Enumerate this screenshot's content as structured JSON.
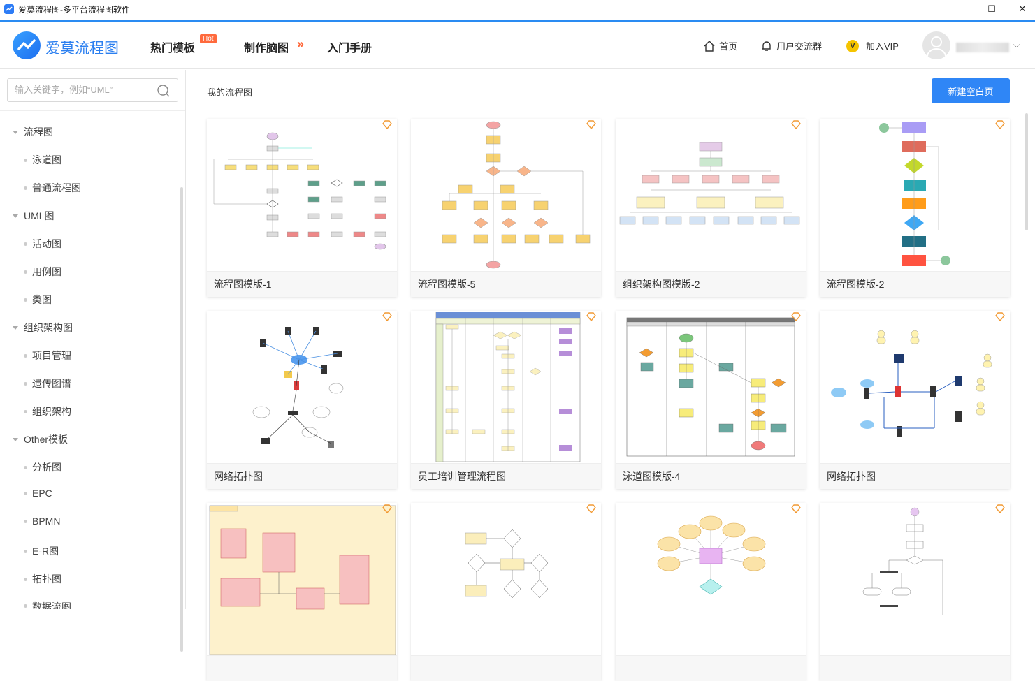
{
  "window": {
    "title": "爱莫流程图-多平台流程图软件",
    "minimize": "—",
    "maximize": "☐",
    "close": "✕"
  },
  "header": {
    "logo_text": "爱莫流程图",
    "nav": {
      "hot_templates": "热门模板",
      "hot_badge": "Hot",
      "mindmap": "制作脑图",
      "manual": "入门手册"
    },
    "right_nav": {
      "home": "首页",
      "user_group": "用户交流群",
      "vip": "加入VIP",
      "vip_letter": "V"
    },
    "accent": "#2a8bf2"
  },
  "sidebar": {
    "search_placeholder": "输入关键字，例如“UML”",
    "groups": [
      {
        "label": "流程图",
        "items": [
          "泳道图",
          "普通流程图"
        ]
      },
      {
        "label": "UML图",
        "items": [
          "活动图",
          "用例图",
          "类图"
        ]
      },
      {
        "label": "组织架构图",
        "items": [
          "项目管理",
          "遗传图谱",
          "组织架构"
        ]
      },
      {
        "label": "Other模板",
        "items": [
          "分析图",
          "EPC",
          "BPMN",
          "E-R图",
          "拓扑图",
          "数据流图"
        ]
      }
    ]
  },
  "main": {
    "title": "我的流程图",
    "new_button": "新建空白页",
    "cards": [
      "流程图模版-1",
      "流程图模版-5",
      "组织架构图模版-2",
      "流程图模版-2",
      "网络拓扑图",
      "员工培训管理流程图",
      "泳道图模版-4",
      "网络拓扑图",
      "",
      "",
      "",
      ""
    ]
  }
}
